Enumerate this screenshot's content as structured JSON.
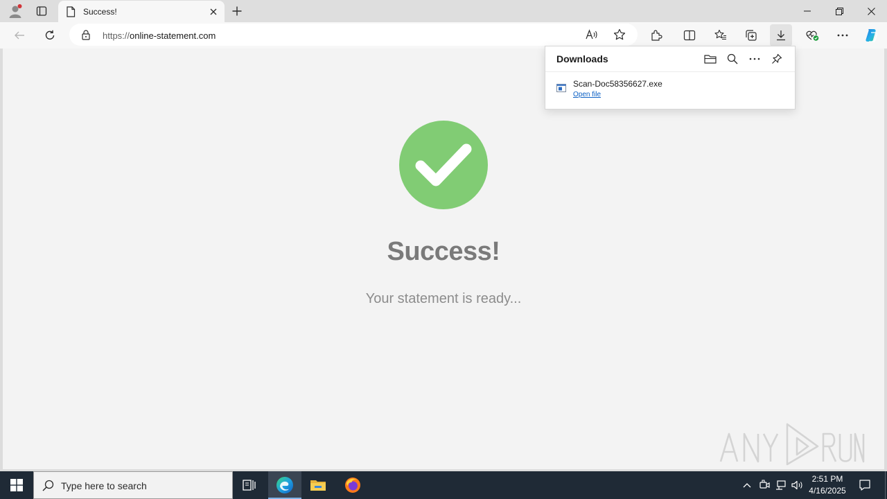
{
  "browser": {
    "tab": {
      "title": "Success!"
    },
    "address": {
      "url_scheme": "https://",
      "url_host": "online-statement.com"
    }
  },
  "page": {
    "heading": "Success!",
    "subtext": "Your statement is ready...",
    "check_color": "#81cc74"
  },
  "downloads": {
    "title": "Downloads",
    "items": [
      {
        "file_name": "Scan-Doc58356627.exe",
        "action_label": "Open file"
      }
    ]
  },
  "watermark": {
    "text": "ANY RUN"
  },
  "taskbar": {
    "search_placeholder": "Type here to search",
    "time": "2:51 PM",
    "date": "4/16/2025"
  },
  "icons": {
    "tabbar": [
      "profile-icon",
      "tab-actions-icon",
      "page-icon",
      "close-icon",
      "plus-icon",
      "minimize-icon",
      "restore-icon",
      "close-window-icon"
    ],
    "toolbar": [
      "back-icon",
      "refresh-icon",
      "lock-icon",
      "read-aloud-icon",
      "favorite-star-icon",
      "extensions-icon",
      "split-screen-icon",
      "favorites-icon",
      "collections-icon",
      "download-icon",
      "browser-essentials-icon",
      "more-icon",
      "copilot-icon"
    ],
    "taskbar": [
      "windows-start-icon",
      "search-icon",
      "task-view-icon",
      "edge-icon",
      "file-explorer-icon",
      "firefox-icon",
      "chevron-up-icon",
      "meet-now-icon",
      "network-icon",
      "volume-icon",
      "notifications-icon"
    ]
  }
}
